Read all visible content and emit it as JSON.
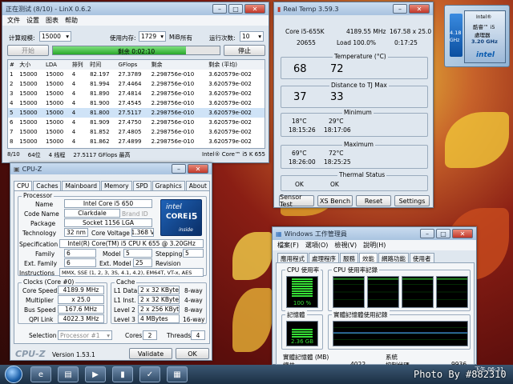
{
  "linx": {
    "title": "正在测试 (8/10) - LinX 0.6.2",
    "menu": [
      "文件",
      "设置",
      "图表",
      "帮助"
    ],
    "problem_size_label": "计算规模:",
    "problem_size_value": "15000",
    "memory_label": "使用内存:",
    "memory_value": "1729",
    "memory_unit": "MiB",
    "memory_all": "所有",
    "runs_label": "运行次数:",
    "runs_value": "10",
    "start_label": "开始",
    "progress_text": "剩余 0:02:10",
    "progress_fraction": 0.8,
    "stop_label": "停止",
    "columns": [
      "#",
      "大小",
      "LDA",
      "排列",
      "时间",
      "GFlops",
      "剩余",
      "剩余 (平均)"
    ],
    "rows": [
      [
        "1",
        "15000",
        "15000",
        "4",
        "82.197",
        "27.3789",
        "2.298756e-010",
        "3.620579e-002"
      ],
      [
        "2",
        "15000",
        "15000",
        "4",
        "81.994",
        "27.4464",
        "2.298756e-010",
        "3.620579e-002"
      ],
      [
        "3",
        "15000",
        "15000",
        "4",
        "81.890",
        "27.4814",
        "2.298756e-010",
        "3.620579e-002"
      ],
      [
        "4",
        "15000",
        "15000",
        "4",
        "81.900",
        "27.4545",
        "2.298756e-010",
        "3.620579e-002"
      ],
      [
        "5",
        "15000",
        "15000",
        "4",
        "81.800",
        "27.5117",
        "2.298756e-010",
        "3.620579e-002"
      ],
      [
        "6",
        "15000",
        "15000",
        "4",
        "81.909",
        "27.4750",
        "2.298756e-010",
        "3.620579e-002"
      ],
      [
        "7",
        "15000",
        "15000",
        "4",
        "81.852",
        "27.4805",
        "2.298756e-010",
        "3.620579e-002"
      ],
      [
        "8",
        "15000",
        "15000",
        "4",
        "81.862",
        "27.4899",
        "2.298756e-010",
        "3.620579e-002"
      ]
    ],
    "status": [
      "8/10",
      "64位",
      "4 线程",
      "27.5117 GFlops 最高",
      "Intel® Core™ i5 K 655"
    ]
  },
  "realtemp": {
    "title": "Real Temp 3.59.3",
    "cpu": "Core i5-655K",
    "freq": "4189.55 MHz",
    "multi": "167.58 x 25.0",
    "vid": "20655",
    "load": "Load 100.0%",
    "time": "0:17:25",
    "temp_label": "Temperature (°C)",
    "temps": [
      "68",
      "72"
    ],
    "dist_label": "Distance to TJ Max",
    "dists": [
      "37",
      "33"
    ],
    "min_label": "Minimum",
    "min_vals": [
      "18°C",
      "29°C"
    ],
    "min_times": [
      "18:15:26",
      "18:17:06"
    ],
    "max_label": "Maximum",
    "max_vals": [
      "69°C",
      "72°C"
    ],
    "max_times": [
      "18:26:00",
      "18:25:25"
    ],
    "thermal_label": "Thermal Status",
    "thermal": [
      "OK",
      "OK"
    ],
    "buttons": [
      "Sensor Test",
      "XS Bench",
      "Reset",
      "Settings"
    ]
  },
  "badge": {
    "lines": [
      "Intel®",
      "酷睿™ i5",
      "處理器"
    ],
    "freq_top": "4.18",
    "freq_unit": "GHz",
    "freq": "3.20 GHz",
    "brand": "intel"
  },
  "cpuz": {
    "title": "CPU-Z",
    "tabs": [
      "CPU",
      "Caches",
      "Mainboard",
      "Memory",
      "SPD",
      "Graphics",
      "About"
    ],
    "processor_group": "Processor",
    "name_label": "Name",
    "name": "Intel Core i5 650",
    "codename_label": "Code Name",
    "codename": "Clarkdale",
    "brandid_label": "Brand ID",
    "package_label": "Package",
    "package": "Socket 1156 LGA",
    "tech_label": "Technology",
    "tech": "32 nm",
    "voltage_label": "Core Voltage",
    "voltage": "1.368 V",
    "spec_label": "Specification",
    "spec": "Intel(R) Core(TM) i5 CPU      K 655  @ 3.20GHz",
    "family_label": "Family",
    "family": "6",
    "model_label": "Model",
    "model": "5",
    "stepping_label": "Stepping",
    "stepping": "5",
    "extfam_label": "Ext. Family",
    "extfam": "6",
    "extmodel_label": "Ext. Model",
    "extmodel": "25",
    "revision_label": "Revision",
    "instr_label": "Instructions",
    "instr": "MMX, SSE (1, 2, 3, 3S, 4.1, 4.2), EM64T, VT-x, AES",
    "clocks_group": "Clocks (Core #0)",
    "corespeed_label": "Core Speed",
    "corespeed": "4189.9 MHz",
    "multiplier_label": "Multiplier",
    "multiplier": "x 25.0",
    "busspeed_label": "Bus Speed",
    "busspeed": "167.6 MHz",
    "qpi_label": "QPI Link",
    "qpi": "4022.3 MHz",
    "cache_group": "Cache",
    "l1d_label": "L1 Data",
    "l1d": "2 x 32 KBytes",
    "l1d_way": "8-way",
    "l1i_label": "L1 Inst.",
    "l1i": "2 x 32 KBytes",
    "l1i_way": "4-way",
    "l2_label": "Level 2",
    "l2": "2 x 256 KBytes",
    "l2_way": "8-way",
    "l3_label": "Level 3",
    "l3": "4 MBytes",
    "l3_way": "16-way",
    "selection_label": "Selection",
    "selection": "Processor #1",
    "cores_label": "Cores",
    "cores": "2",
    "threads_label": "Threads",
    "threads": "4",
    "logo": "CPU-Z",
    "version": "Version 1.53.1",
    "validate": "Validate",
    "ok": "OK",
    "intel_logo": [
      "intel",
      "CORE",
      "i5",
      "inside"
    ]
  },
  "taskmgr": {
    "title": "Windows 工作管理員",
    "menu": [
      "檔案(F)",
      "選項(O)",
      "檢視(V)",
      "說明(H)"
    ],
    "tabs": [
      "應用程式",
      "處理程序",
      "服務",
      "效能",
      "網路功能",
      "使用者"
    ],
    "cpu_usage_label": "CPU 使用率",
    "cpu_usage": "100 %",
    "cpu_usage_fraction": 1.0,
    "cpu_history_label": "CPU 使用率記錄",
    "mem_label": "記憶體",
    "mem_value": "2.36 GB",
    "mem_fraction": 0.55,
    "mem_history_label": "實體記憶體使用記錄",
    "phys_label": "實體記憶體 (MB)",
    "total_label": "總共",
    "total_value": "4022",
    "system_label": "系統",
    "handles_label": "控制代碼",
    "handles_value": "9936"
  },
  "taskbar": {
    "clock": "下午 06:31",
    "watermark": "Photo By #882310"
  }
}
